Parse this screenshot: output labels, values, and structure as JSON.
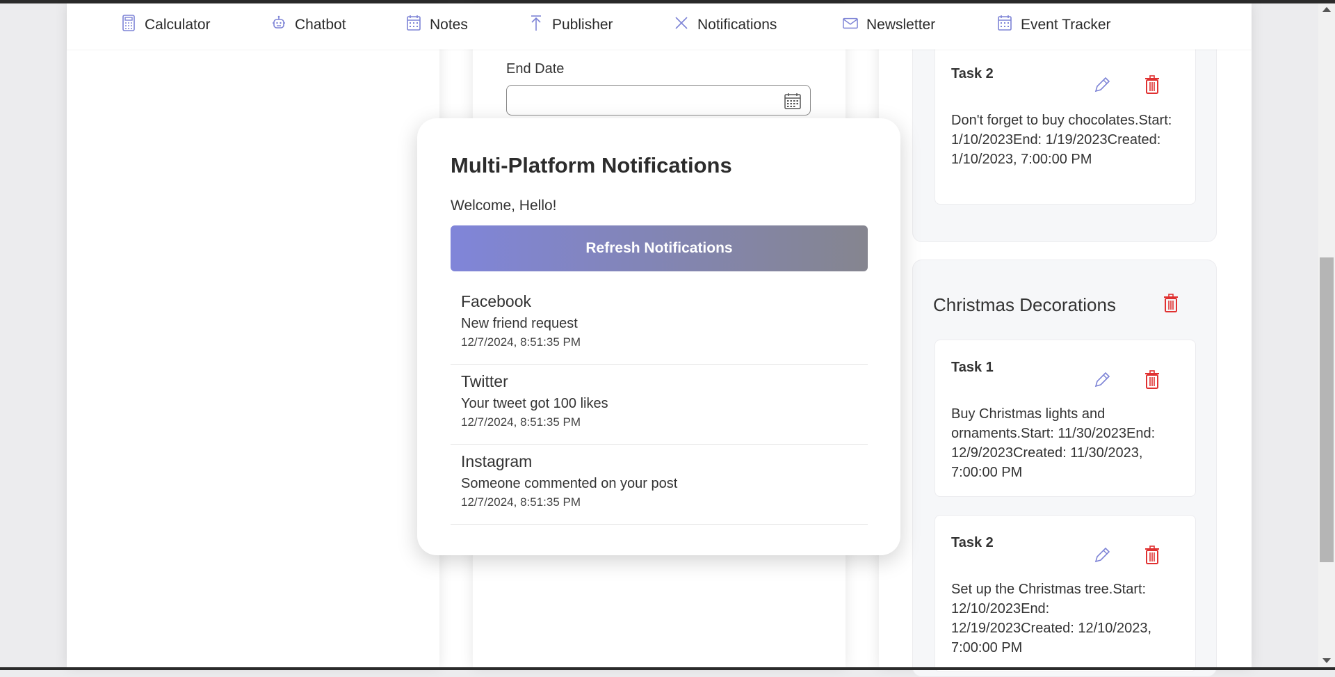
{
  "nav": {
    "items": [
      {
        "label": "Calculator",
        "icon": "calculator-icon"
      },
      {
        "label": "Chatbot",
        "icon": "robot-icon"
      },
      {
        "label": "Notes",
        "icon": "calendar-icon"
      },
      {
        "label": "Publisher",
        "icon": "upload-arrow-icon"
      },
      {
        "label": "Notifications",
        "icon": "close-x-icon"
      },
      {
        "label": "Newsletter",
        "icon": "envelope-icon"
      },
      {
        "label": "Event Tracker",
        "icon": "calendar-icon"
      }
    ]
  },
  "form": {
    "end_date_label": "End Date",
    "end_date_value": ""
  },
  "tasks": {
    "top_group": {
      "task": {
        "title": "Task 2",
        "description": "Don't forget to buy chocolates.Start: 1/10/2023End: 1/19/2023Created: 1/10/2023, 7:00:00 PM"
      }
    },
    "christmas_group": {
      "title": "Christmas Decorations",
      "tasks": [
        {
          "title": "Task 1",
          "description": "Buy Christmas lights and ornaments.Start: 11/30/2023End: 12/9/2023Created: 11/30/2023, 7:00:00 PM"
        },
        {
          "title": "Task 2",
          "description": "Set up the Christmas tree.Start: 12/10/2023End: 12/19/2023Created: 12/10/2023, 7:00:00 PM"
        }
      ]
    }
  },
  "modal": {
    "title": "Multi-Platform Notifications",
    "welcome": "Welcome, Hello!",
    "refresh_label": "Refresh Notifications",
    "notifications": [
      {
        "platform": "Facebook",
        "message": "New friend request",
        "time": "12/7/2024, 8:51:35 PM"
      },
      {
        "platform": "Twitter",
        "message": "Your tweet got 100 likes",
        "time": "12/7/2024, 8:51:35 PM"
      },
      {
        "platform": "Instagram",
        "message": "Someone commented on your post",
        "time": "12/7/2024, 8:51:35 PM"
      }
    ]
  },
  "colors": {
    "accent": "#7d83d6",
    "delete": "#e03131",
    "edit": "#7d83d6"
  }
}
